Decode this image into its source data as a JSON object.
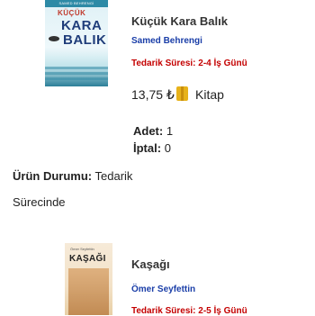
{
  "item1": {
    "cover": {
      "publisher_strip": "SAMED BEHRENGİ",
      "title_small": "KÜÇÜK",
      "title_line1": "KARA",
      "title_line2": "BALIK"
    },
    "title": "Küçük Kara Balık",
    "author": "Samed Behrengi",
    "supply_time": "Tedarik Süresi: 2-4 İş Günü",
    "price": "13,75 ₺",
    "price_type": "Kitap",
    "quantity_label": "Adet:",
    "quantity_value": "1",
    "cancel_label": "İptal:",
    "cancel_value": "0",
    "status_label": "Ürün Durumu:",
    "status_value_line1": "Tedarik",
    "status_value_line2": "Sürecinde"
  },
  "item2": {
    "cover": {
      "author_small": "Ömer Seyfettin",
      "title": "KAŞAĞI"
    },
    "title": "Kaşağı",
    "author": "Ömer Seyfettin",
    "supply_time": "Tedarik Süresi: 2-5 İş Günü"
  },
  "colors": {
    "author_blue": "#1a3ea8",
    "supply_red": "#c40000",
    "book_icon": "#e7b21a"
  }
}
